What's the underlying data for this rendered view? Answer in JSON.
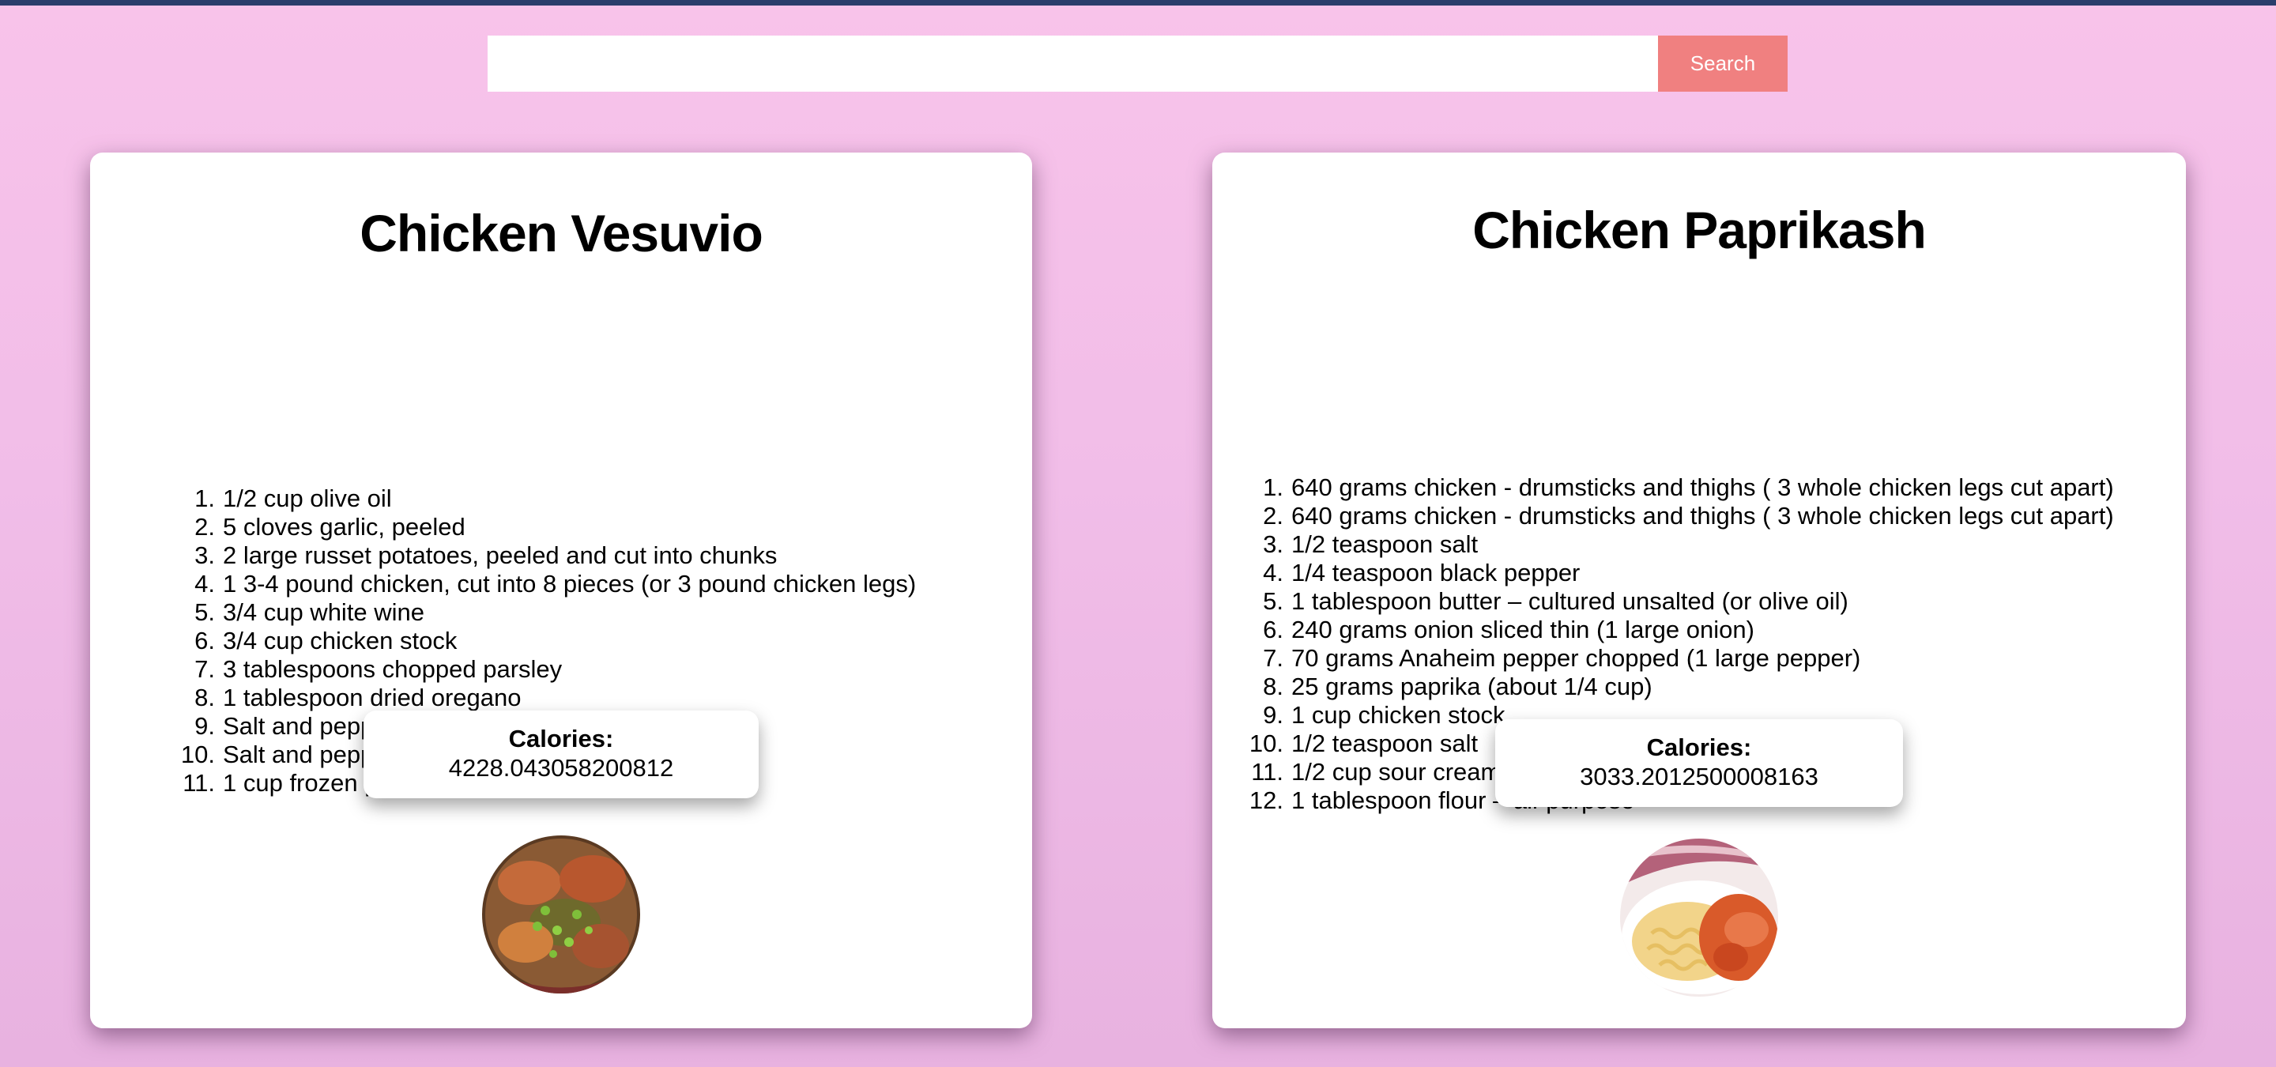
{
  "search": {
    "value": "",
    "placeholder": "",
    "button_label": "Search"
  },
  "recipes": [
    {
      "title": "Chicken Vesuvio",
      "ingredients": [
        "1/2 cup olive oil",
        "5 cloves garlic, peeled",
        "2 large russet potatoes, peeled and cut into chunks",
        "1 3-4 pound chicken, cut into 8 pieces (or 3 pound chicken legs)",
        "3/4 cup white wine",
        "3/4 cup chicken stock",
        "3 tablespoons chopped parsley",
        "1 tablespoon dried oregano",
        "Salt and pepper",
        "Salt and pepper",
        "1 cup frozen peas, thawed"
      ],
      "calories_label": "Calories:",
      "calories_value": "4228.043058200812"
    },
    {
      "title": "Chicken Paprikash",
      "ingredients": [
        "640 grams chicken - drumsticks and thighs ( 3 whole chicken legs cut apart)",
        "640 grams chicken - drumsticks and thighs ( 3 whole chicken legs cut apart)",
        "1/2 teaspoon salt",
        "1/4 teaspoon black pepper",
        "1 tablespoon butter – cultured unsalted (or olive oil)",
        "240 grams onion sliced thin (1 large onion)",
        "70 grams Anaheim pepper chopped (1 large pepper)",
        "25 grams paprika (about 1/4 cup)",
        "1 cup chicken stock",
        "1/2 teaspoon salt",
        "1/2 cup sour cream",
        "1 tablespoon flour – all-purpose"
      ],
      "calories_label": "Calories:",
      "calories_value": "3033.2012500008163"
    }
  ],
  "colors": {
    "background_top": "#f8c3ea",
    "background_bottom": "#e8b2e0",
    "top_bar": "#2a3d6b",
    "search_button": "#f08080",
    "card": "#ffffff"
  }
}
